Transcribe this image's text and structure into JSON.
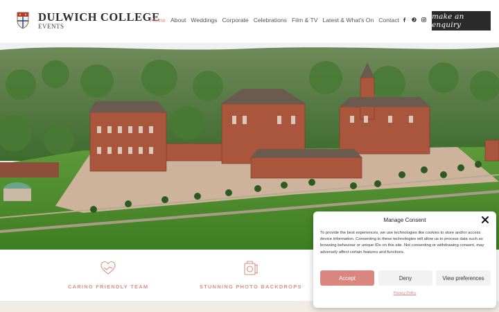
{
  "brand": {
    "title": "DULWICH COLLEGE",
    "subtitle": "EVENTS"
  },
  "nav": {
    "items": [
      {
        "label": "Home",
        "active": true
      },
      {
        "label": "About"
      },
      {
        "label": "Weddings"
      },
      {
        "label": "Corporate"
      },
      {
        "label": "Celebrations"
      },
      {
        "label": "Film & TV"
      },
      {
        "label": "Latest & What's On"
      },
      {
        "label": "Contact"
      }
    ]
  },
  "social": [
    "facebook-icon",
    "pinterest-icon",
    "instagram-icon"
  ],
  "cta": {
    "label": "make an enquiry"
  },
  "features": [
    {
      "label": "CARING FRIENDLY TEAM",
      "icon": "heart-hands-icon"
    },
    {
      "label": "STUNNING PHOTO BACKDROPS",
      "icon": "photo-camera-icon"
    }
  ],
  "cookie": {
    "title": "Manage Consent",
    "body": "To provide the best experiences, we use technologies like cookies to store and/or access device information. Consenting to these technologies will allow us to process data such as browsing behaviour or unique IDs on this site. Not consenting or withdrawing consent, may adversely affect certain features and functions.",
    "accept": "Accept",
    "deny": "Deny",
    "preferences": "View preferences",
    "privacy": "Privacy Policy"
  },
  "colors": {
    "accent": "#d98f86",
    "dark": "#2a2a2a",
    "accept": "#d98580"
  }
}
